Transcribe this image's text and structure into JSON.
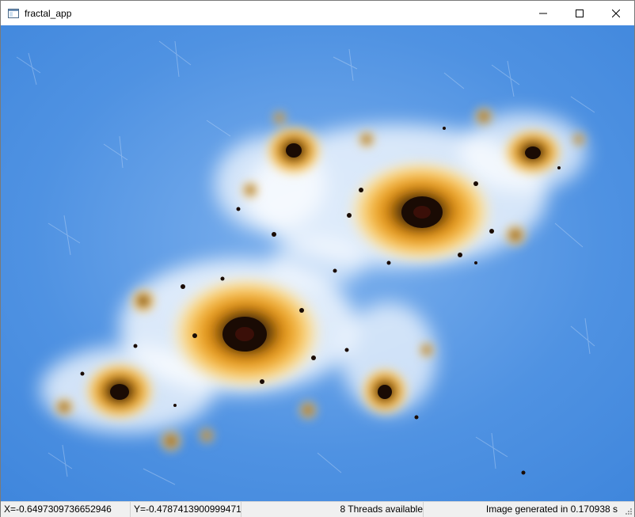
{
  "window": {
    "title": "fractal_app"
  },
  "status": {
    "x_coord": "X=-0.6497309736652946",
    "y_coord": "Y=-0.4787413900999471",
    "threads": "8 Threads available",
    "render_time": "Image generated in 0.170938 s"
  },
  "colors": {
    "background_blue": "#4a8fe0",
    "filament_white": "#e8f2ff",
    "halo_yellow": "#f6c45a",
    "core_orange": "#d98a12",
    "core_dark": "#2b1a08"
  }
}
